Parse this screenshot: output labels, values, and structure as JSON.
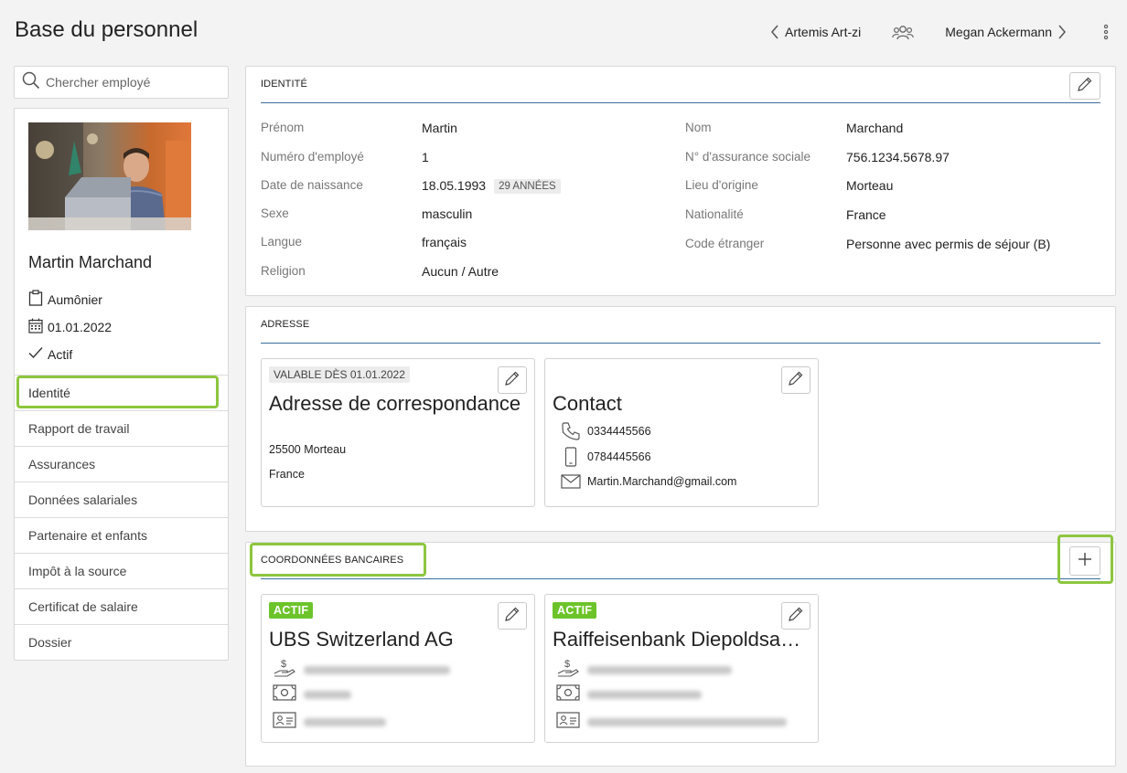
{
  "header": {
    "title": "Base du personnel",
    "prev_employee": "Artemis Art-zi",
    "next_employee": "Megan Ackermann"
  },
  "search": {
    "placeholder": "Chercher employé"
  },
  "profile": {
    "name": "Martin Marchand",
    "role": "Aumônier",
    "start_date": "01.01.2022",
    "status": "Actif"
  },
  "menu": [
    {
      "label": "Identité"
    },
    {
      "label": "Rapport de travail"
    },
    {
      "label": "Assurances"
    },
    {
      "label": "Données salariales"
    },
    {
      "label": "Partenaire et enfants"
    },
    {
      "label": "Impôt à la source"
    },
    {
      "label": "Certificat de salaire"
    },
    {
      "label": "Dossier"
    }
  ],
  "identity": {
    "title": "IDENTITÉ",
    "fields_left": [
      {
        "label": "Prénom",
        "value": "Martin"
      },
      {
        "label": "Numéro d'employé",
        "value": "1"
      },
      {
        "label": "Date de naissance",
        "value": "18.05.1993",
        "badge": "29 ANNÉES"
      },
      {
        "label": "Sexe",
        "value": "masculin"
      },
      {
        "label": "Langue",
        "value": "français"
      },
      {
        "label": "Religion",
        "value": "Aucun / Autre"
      }
    ],
    "fields_right": [
      {
        "label": "Nom",
        "value": "Marchand"
      },
      {
        "label": "N° d'assurance sociale",
        "value": "756.1234.5678.97"
      },
      {
        "label": "Lieu d'origine",
        "value": "Morteau"
      },
      {
        "label": "Nationalité",
        "value": "France"
      },
      {
        "label": "Code étranger",
        "value": "Personne avec permis de séjour (B)"
      }
    ]
  },
  "address": {
    "title": "ADRESSE",
    "postal": {
      "badge": "VALABLE DÈS 01.01.2022",
      "title": "Adresse de correspondance",
      "city": "25500 Morteau",
      "country": "France"
    },
    "contact": {
      "title": "Contact",
      "phone": "0334445566",
      "mobile": "0784445566",
      "email": "Martin.Marchand@gmail.com"
    }
  },
  "bank": {
    "title": "COORDONNÉES BANCAIRES",
    "accounts": [
      {
        "status": "ACTIF",
        "name": "UBS Switzerland AG"
      },
      {
        "status": "ACTIF",
        "name": "Raiffeisenbank Diepoldsau-Schmitter"
      }
    ]
  },
  "colors": {
    "accent_line": "#3c6e9e",
    "active_badge": "#6cc42a",
    "highlight": "#8dc63f"
  }
}
